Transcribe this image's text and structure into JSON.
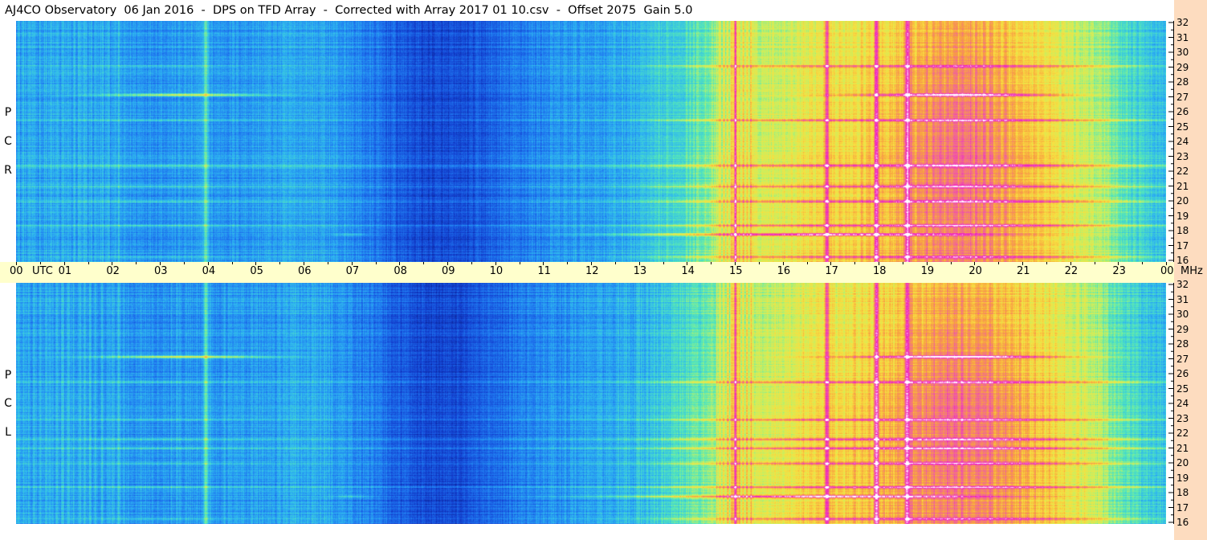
{
  "title": "AJ4CO Observatory  06 Jan 2016  -  DPS on TFD Array  -  Corrected with Array 2017 01 10.csv  -  Offset 2075  Gain 5.0",
  "colors": {
    "right_strip": "#fddcbf",
    "time_axis_bg": "#ffffcc",
    "colormap": [
      "#0a1f8a",
      "#1340d0",
      "#1f78f0",
      "#2fb8f0",
      "#55e8b8",
      "#c8f060",
      "#f8e040",
      "#f8a040",
      "#f060a0",
      "#f020c0",
      "#ffffff"
    ]
  },
  "chart_data": {
    "type": "heatmap",
    "xlabel": "UTC",
    "ylabel": "MHz",
    "x_unit_label": "UTC",
    "y_unit_label": "MHz",
    "xlim": [
      0,
      24
    ],
    "ylim": [
      16,
      32
    ],
    "x_tick_labels": [
      "00",
      "01",
      "02",
      "03",
      "04",
      "05",
      "06",
      "07",
      "08",
      "09",
      "10",
      "11",
      "12",
      "13",
      "14",
      "15",
      "16",
      "17",
      "18",
      "19",
      "20",
      "21",
      "22",
      "23",
      "00"
    ],
    "y_tick_labels": [
      "16",
      "17",
      "18",
      "19",
      "20",
      "21",
      "22",
      "23",
      "24",
      "25",
      "26",
      "27",
      "28",
      "29",
      "30",
      "31",
      "32"
    ],
    "panels": [
      {
        "polarization_label": [
          "R",
          "C",
          "P"
        ],
        "description_levels": "low-to-high intensity index 0-10",
        "band_lines_mhz": [
          27.1,
          25.4,
          21.0,
          17.8,
          18.4,
          20.0,
          16.3,
          22.4,
          29.0
        ],
        "bright_columns_utc": [
          3.95,
          15.0,
          16.92,
          17.95,
          18.6
        ]
      },
      {
        "polarization_label": [
          "L",
          "C",
          "P"
        ],
        "description_levels": "low-to-high intensity index 0-10",
        "band_lines_mhz": [
          27.1,
          25.4,
          21.0,
          17.8,
          18.4,
          20.0,
          16.3,
          22.9,
          21.6
        ],
        "bright_columns_utc": [
          3.95,
          15.0,
          16.92,
          17.95,
          18.6
        ]
      }
    ]
  }
}
